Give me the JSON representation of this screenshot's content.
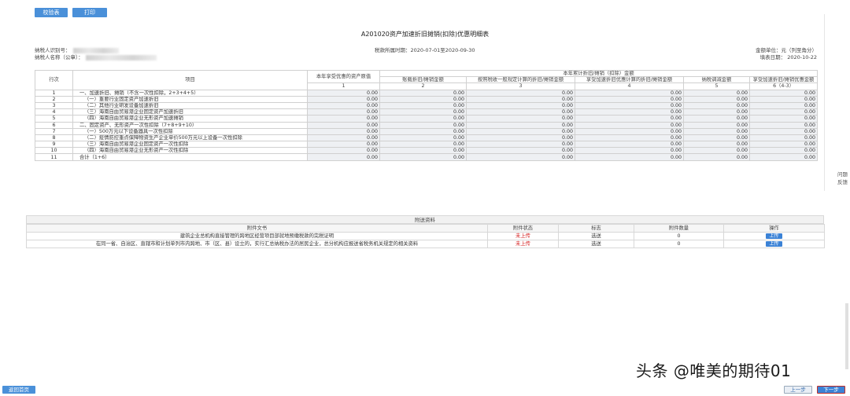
{
  "toolbar": {
    "validate_label": "校验表",
    "print_label": "打印"
  },
  "form": {
    "title": "A201020资产加速折旧摊销(扣除)优惠明细表",
    "taxpayer_id_label": "纳税人识别号：",
    "taxpayer_name_label": "纳税人名称（公章）：",
    "period_label": "税款所属时期：2020-07-01至2020-09-30",
    "unit_label": "金额单位：元（列至角分）",
    "fill_date_label": "填表日期： 2020-10-22"
  },
  "table": {
    "header": {
      "row_no": "行次",
      "item": "项目",
      "col1": "本年享受优惠的资产原值",
      "group": "本年累计折旧/摊销（扣除）金额",
      "col2": "账载折旧/摊销金额",
      "col3": "按照税收一般规定计算的折旧/摊销金额",
      "col4": "享受加速折旧优惠计算的折旧/摊销金额",
      "col5": "纳税调减金额",
      "col6": "享受加速折旧/摊销优惠金额",
      "n1": "1",
      "n2": "2",
      "n3": "3",
      "n4": "4",
      "n5": "5",
      "n6": "6（4-3）"
    },
    "rows": [
      {
        "no": "1",
        "item": "一、加速折旧、摊销（不含一次性扣除，2+3+4+5）",
        "v1": "0.00",
        "v2": "0.00",
        "v3": "0.00",
        "v4": "0.00",
        "v5": "0.00",
        "v6": "0.00"
      },
      {
        "no": "2",
        "item": "（一）重要行业固定资产加速折旧",
        "v1": "0.00",
        "v2": "0.00",
        "v3": "0.00",
        "v4": "0.00",
        "v5": "0.00",
        "v6": "0.00"
      },
      {
        "no": "3",
        "item": "（二）其他行业研发设备加速折旧",
        "v1": "0.00",
        "v2": "0.00",
        "v3": "0.00",
        "v4": "0.00",
        "v5": "0.00",
        "v6": "0.00"
      },
      {
        "no": "4",
        "item": "（三）海南自由贸易港企业固定资产加速折旧",
        "v1": "0.00",
        "v2": "0.00",
        "v3": "0.00",
        "v4": "0.00",
        "v5": "0.00",
        "v6": "0.00"
      },
      {
        "no": "5",
        "item": "（四）海南自由贸易港企业无形资产加速摊销",
        "v1": "0.00",
        "v2": "0.00",
        "v3": "0.00",
        "v4": "0.00",
        "v5": "0.00",
        "v6": "0.00"
      },
      {
        "no": "6",
        "item": "二、固定资产、无形资产一次性扣除（7+8+9+10）",
        "v1": "0.00",
        "v2": "0.00",
        "v3": "0.00",
        "v4": "0.00",
        "v5": "0.00",
        "v6": "0.00"
      },
      {
        "no": "7",
        "item": "（一）500万元以下设备器具一次性扣除",
        "v1": "0.00",
        "v2": "0.00",
        "v3": "0.00",
        "v4": "0.00",
        "v5": "0.00",
        "v6": "0.00"
      },
      {
        "no": "8",
        "item": "（二）疫情防控重点保障物资生产企业单价500万元以上设备一次性扣除",
        "v1": "0.00",
        "v2": "0.00",
        "v3": "0.00",
        "v4": "0.00",
        "v5": "0.00",
        "v6": "0.00"
      },
      {
        "no": "9",
        "item": "（三）海南自由贸易港企业固定资产一次性扣除",
        "v1": "0.00",
        "v2": "0.00",
        "v3": "0.00",
        "v4": "0.00",
        "v5": "0.00",
        "v6": "0.00"
      },
      {
        "no": "10",
        "item": "（四）海南自由贸易港企业无形资产一次性扣除",
        "v1": "0.00",
        "v2": "0.00",
        "v3": "0.00",
        "v4": "0.00",
        "v5": "0.00",
        "v6": "0.00"
      },
      {
        "no": "11",
        "item": "合计（1+6）",
        "v1": "0.00",
        "v2": "0.00",
        "v3": "0.00",
        "v4": "0.00",
        "v5": "0.00",
        "v6": "0.00"
      }
    ]
  },
  "side": {
    "feedback_1": "问题",
    "feedback_2": "反馈"
  },
  "attachments": {
    "title": "附送资料",
    "headers": {
      "doc": "附件文书",
      "status": "附件状态",
      "flag": "标志",
      "count": "附件数量",
      "action": "操作"
    },
    "rows": [
      {
        "doc": "建筑企业总机构直接管理的跨地区经营项目部就地预缴税款的完税证明",
        "status": "未上传",
        "flag": "选送",
        "count": "0",
        "action": "上传"
      },
      {
        "doc": "在同一省、自治区、直辖市和计划单列市内跨地、市（区、县）设立的，实行汇总纳税办法的居民企业，总分机构应报送省税务机关规定的相关资料",
        "status": "未上传",
        "flag": "选送",
        "count": "0",
        "action": "上传"
      }
    ]
  },
  "footer": {
    "home_label": "返回首页",
    "prev_label": "上一步",
    "next_label": "下一步"
  },
  "watermark": "头条 @唯美的期待01",
  "colors": {
    "primary_button": "#4a90d9",
    "status_red": "#d42020",
    "readonly_cell": "#eef0f3"
  }
}
